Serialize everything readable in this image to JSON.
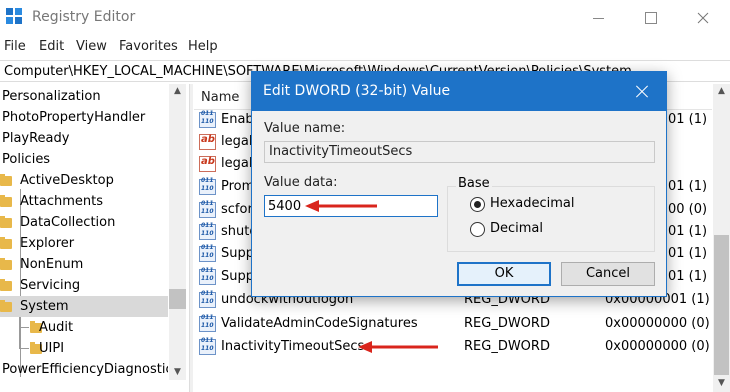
{
  "window": {
    "title": "Registry Editor"
  },
  "menu": [
    "File",
    "Edit",
    "View",
    "Favorites",
    "Help"
  ],
  "address": "Computer\\HKEY_LOCAL_MACHINE\\SOFTWARE\\Microsoft\\Windows\\CurrentVersion\\Policies\\System",
  "tree": {
    "items": [
      {
        "label": "Personalization",
        "indent": 0,
        "folder": false
      },
      {
        "label": "PhotoPropertyHandler",
        "indent": 0,
        "folder": false
      },
      {
        "label": "PlayReady",
        "indent": 0,
        "folder": false
      },
      {
        "label": "Policies",
        "indent": 0,
        "folder": false
      },
      {
        "label": "ActiveDesktop",
        "indent": 1,
        "folder": true
      },
      {
        "label": "Attachments",
        "indent": 1,
        "folder": true
      },
      {
        "label": "DataCollection",
        "indent": 1,
        "folder": true
      },
      {
        "label": "Explorer",
        "indent": 1,
        "folder": true
      },
      {
        "label": "NonEnum",
        "indent": 1,
        "folder": true
      },
      {
        "label": "Servicing",
        "indent": 1,
        "folder": true
      },
      {
        "label": "System",
        "indent": 1,
        "folder": true,
        "selected": true
      },
      {
        "label": "Audit",
        "indent": 2,
        "folder": true
      },
      {
        "label": "UIPI",
        "indent": 2,
        "folder": true
      },
      {
        "label": "PowerEfficiencyDiagnostics",
        "indent": 0,
        "folder": false
      }
    ]
  },
  "list": {
    "columns": {
      "name": "Name"
    },
    "rows": [
      {
        "name": "Enab",
        "type": "",
        "data": "01 (1)",
        "icon": "bin"
      },
      {
        "name": "legal",
        "type": "",
        "data": "",
        "icon": "sz"
      },
      {
        "name": "legal",
        "type": "",
        "data": "",
        "icon": "sz"
      },
      {
        "name": "Prom",
        "type": "",
        "data": "01 (1)",
        "icon": "bin"
      },
      {
        "name": "scfor",
        "type": "",
        "data": "00 (0)",
        "icon": "bin"
      },
      {
        "name": "shutd",
        "type": "",
        "data": "01 (1)",
        "icon": "bin"
      },
      {
        "name": "Supp",
        "type": "",
        "data": "01 (1)",
        "icon": "bin"
      },
      {
        "name": "Supp",
        "type": "",
        "data": "01 (1)",
        "icon": "bin"
      },
      {
        "name": "undockwithoutlogon",
        "type": "REG_DWORD",
        "data": "0x00000001 (1)",
        "icon": "bin"
      },
      {
        "name": "ValidateAdminCodeSignatures",
        "type": "REG_DWORD",
        "data": "0x00000000 (0)",
        "icon": "bin"
      },
      {
        "name": "InactivityTimeoutSecs",
        "type": "REG_DWORD",
        "data": "0x00000000 (0)",
        "icon": "bin"
      }
    ]
  },
  "dialog": {
    "title": "Edit DWORD (32-bit) Value",
    "value_name_label": "Value name:",
    "value_name": "InactivityTimeoutSecs",
    "value_data_label": "Value data:",
    "value_data": "5400",
    "base_label": "Base",
    "hex_label": "Hexadecimal",
    "dec_label": "Decimal",
    "ok_label": "OK",
    "cancel_label": "Cancel"
  },
  "colors": {
    "accent": "#1e73c8",
    "annotation_arrow": "#d9251c",
    "selected_row": "#d9d9d9"
  }
}
